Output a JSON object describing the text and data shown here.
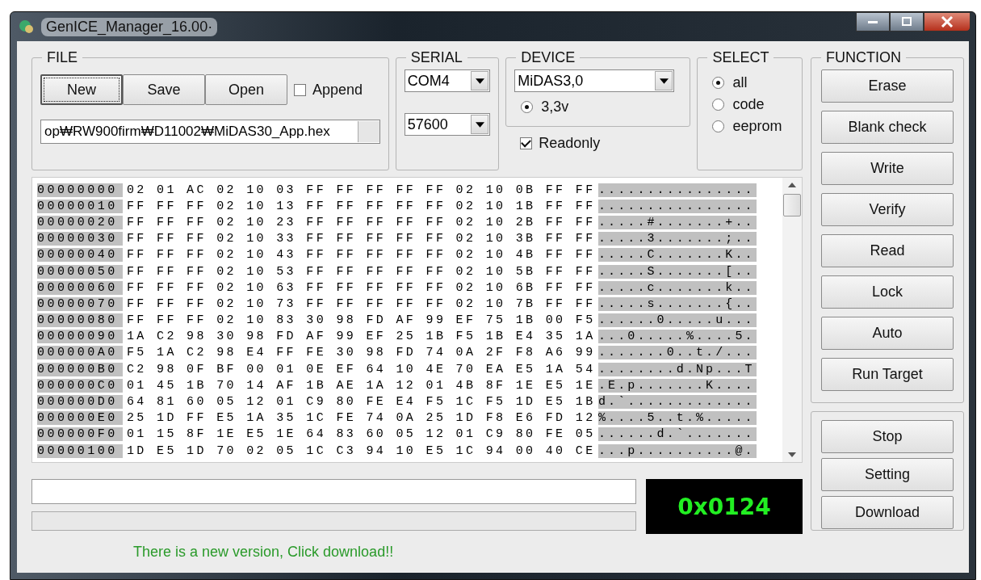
{
  "window": {
    "title": "GenICE_Manager_16.00·"
  },
  "file": {
    "label": "FILE",
    "buttons": [
      {
        "label": "New",
        "focused": true
      },
      {
        "label": "Save",
        "focused": false
      },
      {
        "label": "Open",
        "focused": false
      }
    ],
    "append": {
      "label": "Append",
      "checked": false
    },
    "path": "op₩RW900firm₩D11002₩MiDAS30_App.hex"
  },
  "serial": {
    "label": "SERIAL",
    "port": "COM4",
    "baud": "57600"
  },
  "device": {
    "label": "DEVICE",
    "model": "MiDAS3,0",
    "voltage": {
      "label": "3,3v",
      "selected": true
    },
    "readonly": {
      "label": "Readonly",
      "checked": true
    }
  },
  "select": {
    "label": "SELECT",
    "options": [
      {
        "label": "all",
        "selected": true
      },
      {
        "label": "code",
        "selected": false
      },
      {
        "label": "eeprom",
        "selected": false
      }
    ]
  },
  "function": {
    "label": "FUNCTION",
    "buttons": [
      "Erase",
      "Blank check",
      "Write",
      "Verify",
      "Read",
      "Lock",
      "Auto",
      "Run Target"
    ]
  },
  "control_buttons": [
    "Stop",
    "Setting",
    "Download"
  ],
  "hex_rows": [
    {
      "address": "00000000",
      "bytes": "02 01 AC 02 10 03 FF FF FF FF FF 02 10 0B FF FF",
      "ascii": "................"
    },
    {
      "address": "00000010",
      "bytes": "FF FF FF 02 10 13 FF FF FF FF FF 02 10 1B FF FF",
      "ascii": "................"
    },
    {
      "address": "00000020",
      "bytes": "FF FF FF 02 10 23 FF FF FF FF FF 02 10 2B FF FF",
      "ascii": ".....#.......+.."
    },
    {
      "address": "00000030",
      "bytes": "FF FF FF 02 10 33 FF FF FF FF FF 02 10 3B FF FF",
      "ascii": ".....3.......;.."
    },
    {
      "address": "00000040",
      "bytes": "FF FF FF 02 10 43 FF FF FF FF FF 02 10 4B FF FF",
      "ascii": ".....C.......K.."
    },
    {
      "address": "00000050",
      "bytes": "FF FF FF 02 10 53 FF FF FF FF FF 02 10 5B FF FF",
      "ascii": ".....S.......[.."
    },
    {
      "address": "00000060",
      "bytes": "FF FF FF 02 10 63 FF FF FF FF FF 02 10 6B FF FF",
      "ascii": ".....c.......k.."
    },
    {
      "address": "00000070",
      "bytes": "FF FF FF 02 10 73 FF FF FF FF FF 02 10 7B FF FF",
      "ascii": ".....s.......{.."
    },
    {
      "address": "00000080",
      "bytes": "FF FF FF 02 10 83 30 98 FD AF 99 EF 75 1B 00 F5",
      "ascii": "......0.....u..."
    },
    {
      "address": "00000090",
      "bytes": "1A C2 98 30 98 FD AF 99 EF 25 1B F5 1B E4 35 1A",
      "ascii": "...0.....%....5."
    },
    {
      "address": "000000A0",
      "bytes": "F5 1A C2 98 E4 FF FE 30 98 FD 74 0A 2F F8 A6 99",
      "ascii": ".......0..t./..."
    },
    {
      "address": "000000B0",
      "bytes": "C2 98 0F BF 00 01 0E EF 64 10 4E 70 EA E5 1A 54",
      "ascii": "........d.Np...T"
    },
    {
      "address": "000000C0",
      "bytes": "01 45 1B 70 14 AF 1B AE 1A 12 01 4B 8F 1E E5 1E",
      "ascii": ".E.p.......K...."
    },
    {
      "address": "000000D0",
      "bytes": "64 81 60 05 12 01 C9 80 FE E4 F5 1C F5 1D E5 1B",
      "ascii": "d.`............."
    },
    {
      "address": "000000E0",
      "bytes": "25 1D FF E5 1A 35 1C FE 74 0A 25 1D F8 E6 FD 12",
      "ascii": "%....5..t.%....."
    },
    {
      "address": "000000F0",
      "bytes": "01 15 8F 1E E5 1E 64 83 60 05 12 01 C9 80 FE 05",
      "ascii": "......d.`......."
    },
    {
      "address": "00000100",
      "bytes": "1D E5 1D 70 02 05 1C C3 94 10 E5 1C 94 00 40 CE",
      "ascii": "...p..........@."
    }
  ],
  "progress": {
    "level": 0
  },
  "counter": "0x0124",
  "message": "There is a new version, Click download!!"
}
